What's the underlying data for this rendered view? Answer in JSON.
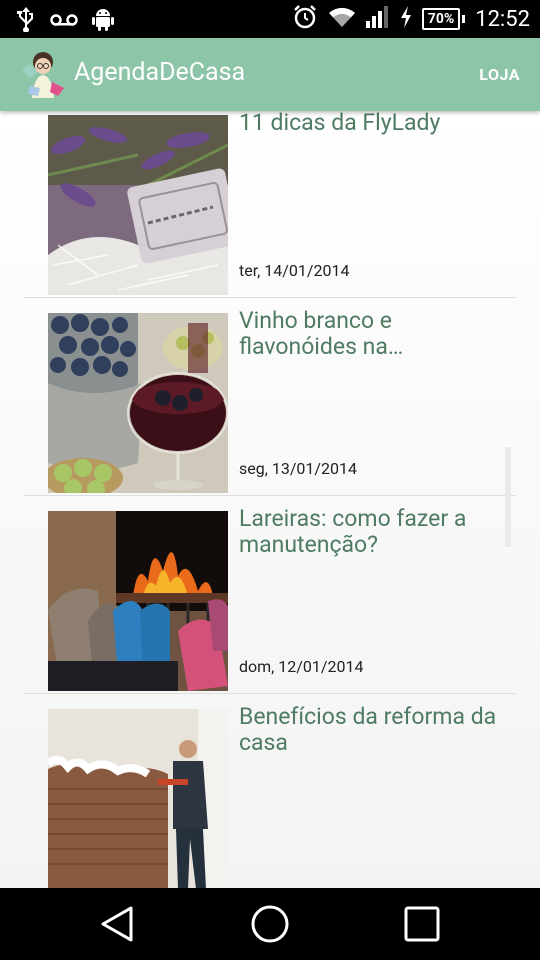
{
  "status_bar": {
    "time": "12:52",
    "battery": "70%",
    "left_icons": [
      "usb-icon",
      "voicemail-icon",
      "android-icon"
    ],
    "right_icons": [
      "alarm-icon",
      "wifi-icon",
      "signal-icon",
      "charging-icon"
    ]
  },
  "action_bar": {
    "title": "AgendaDeCasa",
    "menu_action": "LOJA",
    "color": "#8cc5a8"
  },
  "articles": [
    {
      "title": "11 dicas da FlyLady",
      "date": "ter, 14/01/2014",
      "image": "lavender-soap-photo"
    },
    {
      "title": "Vinho branco e flavonóides na…",
      "date": "seg, 13/01/2014",
      "image": "wine-grapes-photo"
    },
    {
      "title": "Lareiras: como fazer a manutenção?",
      "date": "dom, 12/01/2014",
      "image": "fireplace-socks-photo"
    },
    {
      "title": "Benefícios da reforma da casa",
      "date": "",
      "image": "renovation-brick-wall-photo"
    }
  ],
  "nav_bar": {
    "buttons": [
      "back-icon",
      "home-icon",
      "recents-icon"
    ]
  }
}
